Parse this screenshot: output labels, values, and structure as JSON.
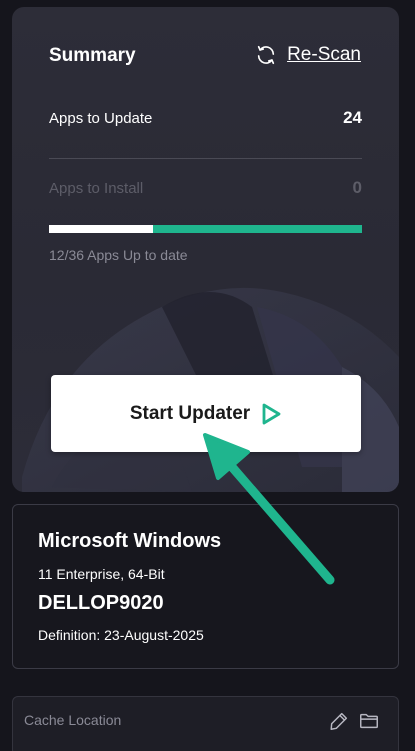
{
  "summary": {
    "title": "Summary",
    "rescan_label": "Re-Scan",
    "apps_to_update_label": "Apps to Update",
    "apps_to_update_count": "24",
    "apps_to_install_label": "Apps to Install",
    "apps_to_install_count": "0",
    "progress_caption": "12/36 Apps Up to date",
    "progress_fraction": 0.333,
    "start_button_label": "Start Updater"
  },
  "system": {
    "os_name": "Microsoft Windows",
    "os_edition": "11 Enterprise, 64-Bit",
    "pc_name": "DELLOP9020",
    "definition": "Definition: 23-August-2025"
  },
  "cache": {
    "label": "Cache Location"
  },
  "colors": {
    "accent": "#1fb58e",
    "background": "#15151c",
    "card": "#2d2d38"
  },
  "icons": [
    "refresh-icon",
    "play-icon",
    "edit-icon",
    "folder-icon",
    "annotation-arrow"
  ]
}
